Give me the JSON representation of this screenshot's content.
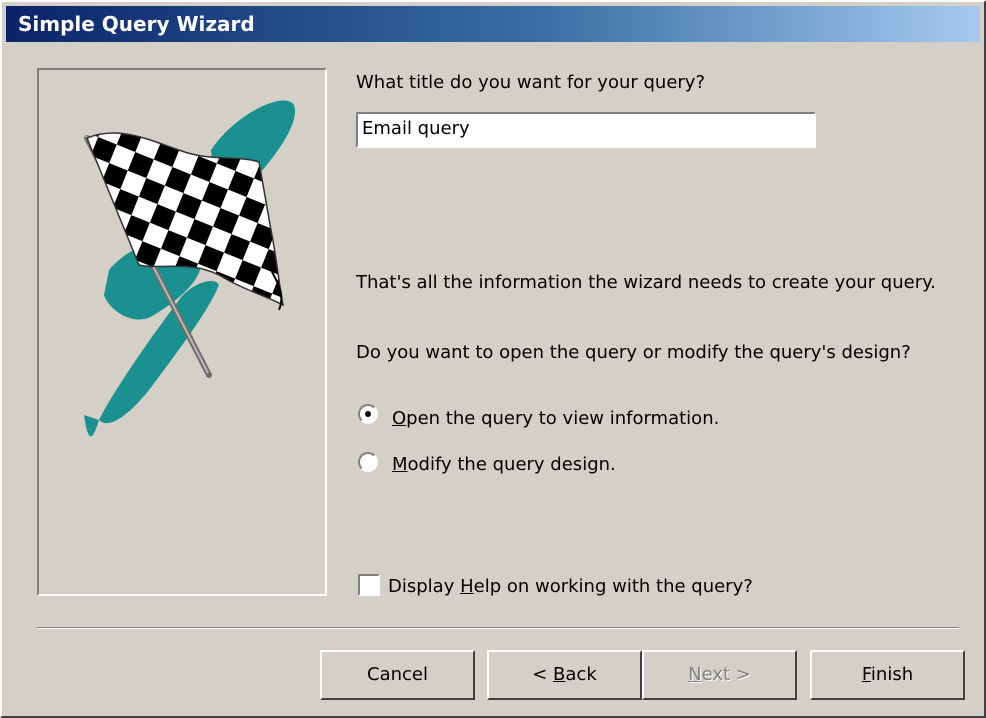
{
  "window": {
    "title": "Simple Query Wizard"
  },
  "form": {
    "title_prompt": "What title do you want for your query?",
    "query_title_value": "Email query",
    "info_text": "That's all the information the wizard needs to create your query.",
    "question": "Do you want to open the query or modify the query's design?",
    "options": [
      {
        "mnemonic": "O",
        "rest": "pen the query to view information.",
        "selected": true
      },
      {
        "mnemonic": "M",
        "rest": "odify the query design.",
        "selected": false
      }
    ],
    "help_checkbox": {
      "before": "Display ",
      "mnemonic": "H",
      "after": "elp on working with the query?",
      "checked": false
    }
  },
  "buttons": {
    "cancel": "Cancel",
    "back": {
      "before": "< ",
      "mnemonic": "B",
      "after": "ack"
    },
    "next": {
      "mnemonic": "N",
      "after": "ext >",
      "enabled": false
    },
    "finish": {
      "mnemonic": "F",
      "after": "inish"
    }
  },
  "icons": {
    "wizard_image": "checkered-flag-icon"
  },
  "colors": {
    "titlebar_start": "#0a246a",
    "titlebar_end": "#a6caf0",
    "face": "#d4d0c8",
    "splash": "#1a9090"
  }
}
